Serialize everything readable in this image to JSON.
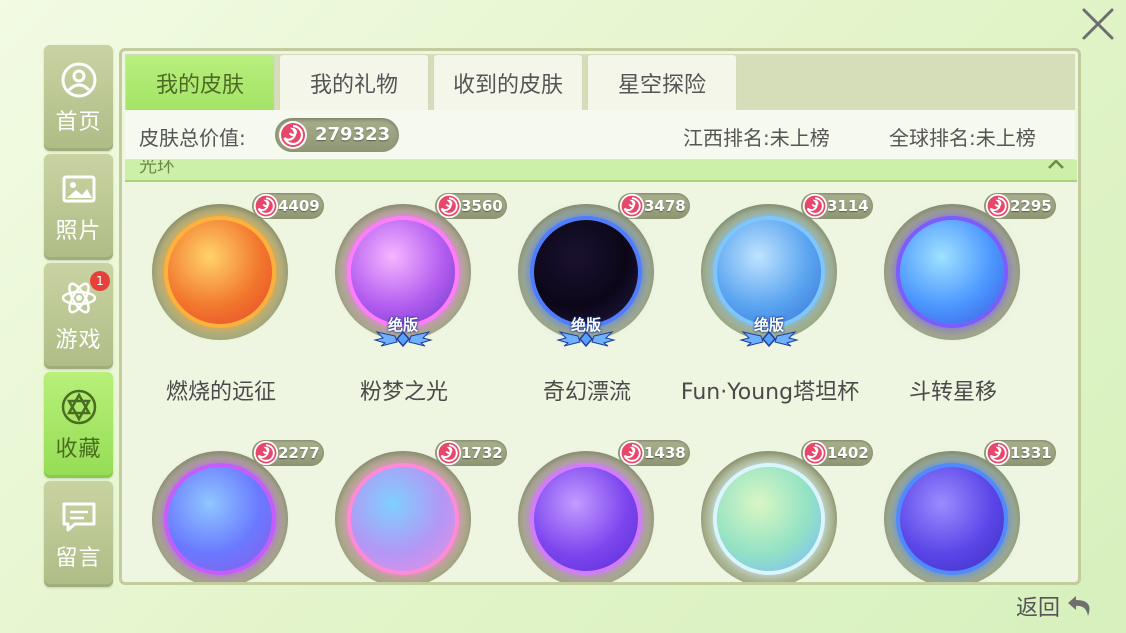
{
  "sidebar": {
    "items": [
      {
        "label": "首页",
        "icon": "user-icon",
        "active": false
      },
      {
        "label": "照片",
        "icon": "photo-icon",
        "active": false
      },
      {
        "label": "游戏",
        "icon": "atom-icon",
        "active": false,
        "badge": "1"
      },
      {
        "label": "收藏",
        "icon": "star-collection-icon",
        "active": true
      },
      {
        "label": "留言",
        "icon": "message-icon",
        "active": false
      }
    ]
  },
  "tabs": [
    {
      "label": "我的皮肤",
      "active": true
    },
    {
      "label": "我的礼物",
      "active": false
    },
    {
      "label": "收到的皮肤",
      "active": false
    },
    {
      "label": "星空探险",
      "active": false
    }
  ],
  "summary": {
    "value_label": "皮肤总价值:",
    "total_value": "279323",
    "jiangxi_rank": "江西排名:未上榜",
    "global_rank": "全球排名:未上榜"
  },
  "section": {
    "title": "光环"
  },
  "skins": [
    {
      "name": "燃烧的远征",
      "price": "4409",
      "limited": false,
      "colors": [
        "#ffd36a",
        "#f2782d",
        "#e5442b"
      ],
      "ring": "#ffb13b"
    },
    {
      "name": "粉梦之光",
      "price": "3560",
      "limited": true,
      "limited_label": "绝版",
      "colors": [
        "#f6b6ff",
        "#b35df0",
        "#6c39c8"
      ],
      "ring": "#ff7cff"
    },
    {
      "name": "奇幻漂流",
      "price": "3478",
      "limited": true,
      "limited_label": "绝版",
      "colors": [
        "#1a1130",
        "#0b0718",
        "#241a48"
      ],
      "ring": "#4f7dff"
    },
    {
      "name": "Fun·Young塔坦杯",
      "price": "3114",
      "limited": true,
      "limited_label": "绝版",
      "colors": [
        "#bfe3ff",
        "#5aa4f0",
        "#3772d8"
      ],
      "ring": "#7ec6ff"
    },
    {
      "name": "斗转星移",
      "price": "2295",
      "limited": false,
      "colors": [
        "#9fe2ff",
        "#4c97ff",
        "#3b58e0"
      ],
      "ring": "#7a5cff"
    },
    {
      "name": "",
      "price": "2277",
      "limited": false,
      "colors": [
        "#8fc7ff",
        "#6a79ff",
        "#8f58e8"
      ],
      "ring": "#c45cff"
    },
    {
      "name": "",
      "price": "1732",
      "limited": false,
      "colors": [
        "#7fd0ff",
        "#b496f5",
        "#ef8fe0"
      ],
      "ring": "#ff8ad8"
    },
    {
      "name": "",
      "price": "1438",
      "limited": false,
      "colors": [
        "#c39bff",
        "#7d46ef",
        "#5a2bd4"
      ],
      "ring": "#d27bff"
    },
    {
      "name": "",
      "price": "1402",
      "limited": false,
      "colors": [
        "#d9f7c3",
        "#93e2c4",
        "#7ab6ff"
      ],
      "ring": "#d9f6ff"
    },
    {
      "name": "",
      "price": "1331",
      "limited": false,
      "colors": [
        "#9b8cff",
        "#5b46e8",
        "#3a30bf"
      ],
      "ring": "#4f8bff"
    }
  ],
  "back_label": "返回"
}
